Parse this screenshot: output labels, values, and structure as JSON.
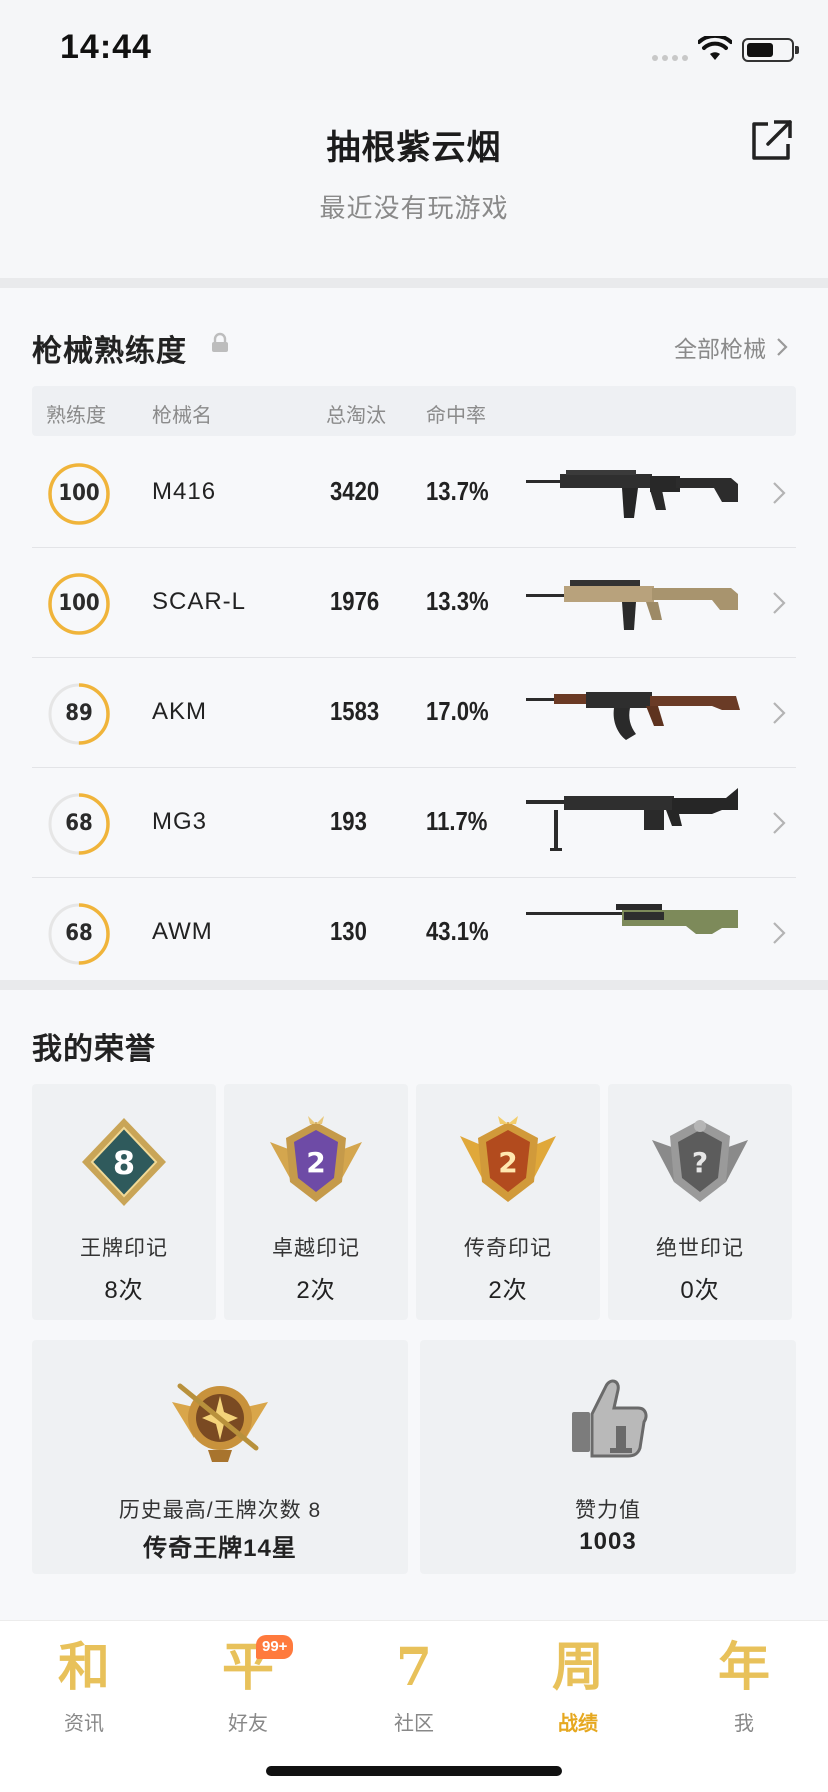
{
  "status_bar": {
    "time": "14:44"
  },
  "profile": {
    "name": "抽根紫云烟",
    "status": "最近没有玩游戏",
    "share_icon": "share-external-icon"
  },
  "weapons": {
    "title": "枪械熟练度",
    "all_link": "全部枪械",
    "columns": {
      "mastery": "熟练度",
      "name": "枪械名",
      "kills": "总淘汰",
      "hit_rate": "命中率"
    },
    "rows": [
      {
        "mastery": "100",
        "mastery_fraction": 1.0,
        "name": "M416",
        "kills": "3420",
        "hit_rate": "13.7%",
        "gun_icon": "m416-rifle-icon"
      },
      {
        "mastery": "100",
        "mastery_fraction": 1.0,
        "name": "SCAR-L",
        "kills": "1976",
        "hit_rate": "13.3%",
        "gun_icon": "scar-l-rifle-icon"
      },
      {
        "mastery": "89",
        "mastery_fraction": 0.5,
        "name": "AKM",
        "kills": "1583",
        "hit_rate": "17.0%",
        "gun_icon": "akm-rifle-icon"
      },
      {
        "mastery": "68",
        "mastery_fraction": 0.5,
        "name": "MG3",
        "kills": "193",
        "hit_rate": "11.7%",
        "gun_icon": "mg3-machine-gun-icon"
      },
      {
        "mastery": "68",
        "mastery_fraction": 0.5,
        "name": "AWM",
        "kills": "130",
        "hit_rate": "43.1%",
        "gun_icon": "awm-sniper-icon"
      }
    ]
  },
  "honors": {
    "title": "我的荣誉",
    "badges": [
      {
        "label": "王牌印记",
        "count": "8次",
        "icon": "ace-mark-badge-icon",
        "number": "8"
      },
      {
        "label": "卓越印记",
        "count": "2次",
        "icon": "excellence-mark-badge-icon",
        "number": "2"
      },
      {
        "label": "传奇印记",
        "count": "2次",
        "icon": "legend-mark-badge-icon",
        "number": "2"
      },
      {
        "label": "绝世印记",
        "count": "0次",
        "icon": "peerless-mark-badge-icon",
        "number": "?"
      }
    ],
    "highest": {
      "label": "历史最高/王牌次数 8",
      "value": "传奇王牌14星",
      "icon": "legend-ace-rank-icon"
    },
    "likes": {
      "label": "赞力值",
      "value": "1003",
      "icon": "thumbs-up-icon"
    }
  },
  "tabbar": {
    "tabs": [
      {
        "glyph": "和",
        "label": "资讯",
        "active": false
      },
      {
        "glyph": "平",
        "label": "好友",
        "active": false,
        "badge": "99+"
      },
      {
        "glyph": "7",
        "label": "社区",
        "active": false
      },
      {
        "glyph": "周",
        "label": "战绩",
        "active": true
      },
      {
        "glyph": "年",
        "label": "我",
        "active": false
      }
    ]
  },
  "colors": {
    "accent": "#f0b43a",
    "ring_track": "#e6e6e6",
    "tab_active": "#e6a820",
    "badge": "#ff7a3d"
  }
}
